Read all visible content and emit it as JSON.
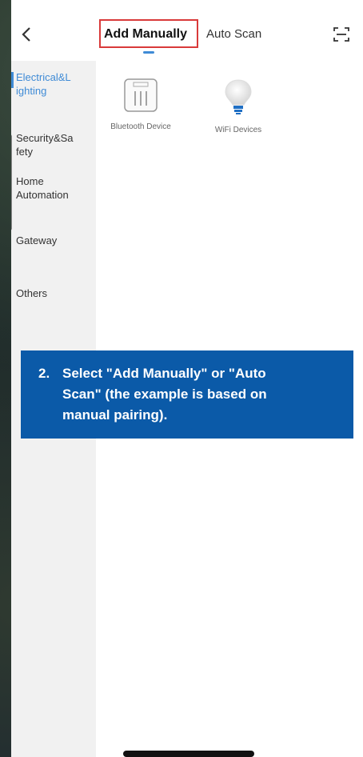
{
  "header": {
    "tabs": [
      {
        "label": "Add Manually",
        "active": true
      },
      {
        "label": "Auto Scan",
        "active": false
      }
    ],
    "back_icon": "chevron-left-icon",
    "scan_icon": "scan-frame-icon"
  },
  "sidebar": {
    "items": [
      {
        "label": "Electrical&L\nighting",
        "active": true
      },
      {
        "label": "Security&Sa\nfety",
        "active": false
      },
      {
        "label": "Home\nAutomation",
        "active": false
      },
      {
        "label": "Gateway",
        "active": false
      },
      {
        "label": "Others",
        "active": false
      }
    ]
  },
  "devices": [
    {
      "label": "Bluetooth Device",
      "icon": "switch-panel-icon"
    },
    {
      "label": "WiFi Devices",
      "icon": "light-bulb-icon"
    }
  ],
  "callout": {
    "number": "2.",
    "text": "Select \"Add Manually\" or \"Auto Scan\" (the example is based on manual pairing)."
  },
  "colors": {
    "accent": "#3f8bd6",
    "highlight_border": "#d93a3a",
    "callout_bg": "#0b5aa8"
  }
}
